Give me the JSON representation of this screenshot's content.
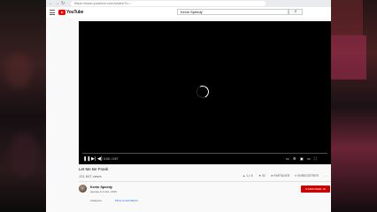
{
  "browser": {
    "address": "https://www.youtube.com/watch?v=..."
  },
  "header": {
    "logo_text": "YouTube",
    "search_value": "Kevin Speedy",
    "menu_icon": "hamburger-menu-icon",
    "search_icon": "search-icon"
  },
  "player": {
    "state": "loading",
    "time": "0:00 / 3:57",
    "controls": [
      "play-icon",
      "next-icon",
      "volume-icon",
      "subtitles-icon",
      "settings-icon",
      "miniplayer-icon",
      "theater-icon",
      "fullscreen-icon"
    ]
  },
  "video": {
    "title": "Let Me Be Frank",
    "views": "131 847 views",
    "actions": {
      "like": "1,1 K",
      "dislike": "52",
      "share": "PARTAGER",
      "save": "ENREGISTRER",
      "more": "..."
    }
  },
  "channel": {
    "name": "Kevin Speedy",
    "published": "Ajoutée le 6 déc. 2016",
    "subscribe_label": "S'ABONNER",
    "subscriber_count": "1K"
  },
  "meta": {
    "category_label": "Catégorie",
    "category_value": "Films et animations"
  },
  "colors": {
    "brand_red": "#ff0000",
    "subscribe_red": "#cc0000",
    "link_blue": "#065fd4"
  }
}
